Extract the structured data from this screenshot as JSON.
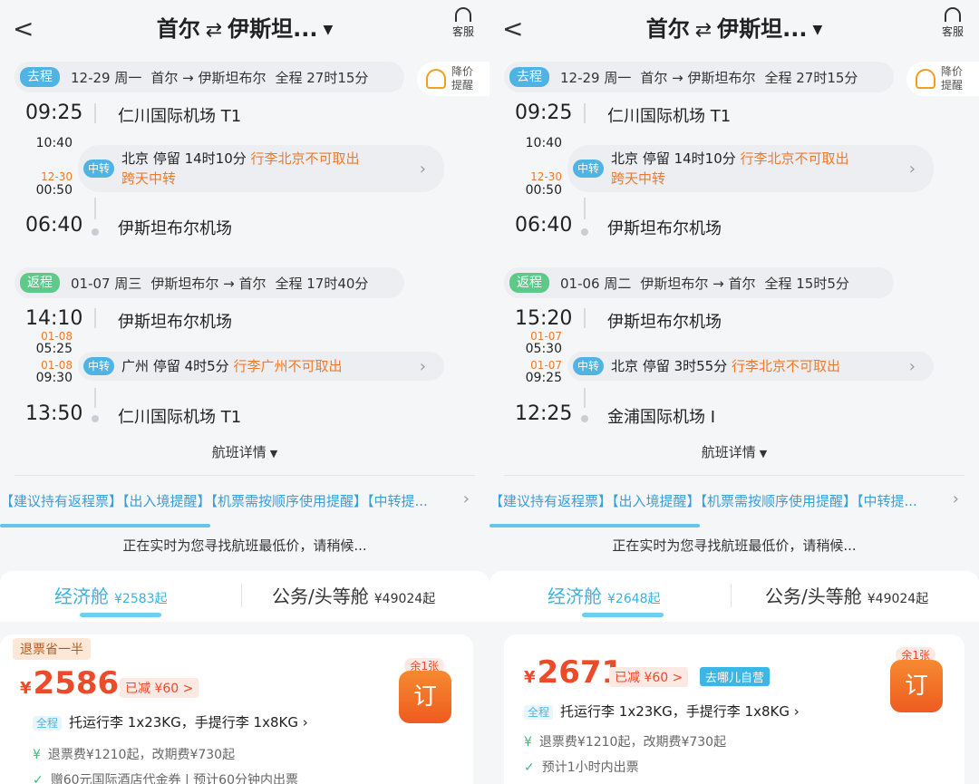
{
  "panels": [
    {
      "header": {
        "back": "<",
        "from": "首尔",
        "swap": "⇄",
        "to": "伊斯坦...",
        "caret": "▼",
        "service": "客服"
      },
      "alert": {
        "line1": "降价",
        "line2": "提醒"
      },
      "outbound": {
        "tag": "去程",
        "date": "12-29 周一",
        "route": "首尔 → 伊斯坦布尔",
        "duration": "全程 27时15分",
        "dep_time": "09:25",
        "dep_airport": "仁川国际机场 T1",
        "arr1_time": "10:40",
        "transfer_tag": "中转",
        "stop_city": "北京",
        "stop_info": "停留 14时10分",
        "stop_warn": "行李北京不可取出",
        "stop_warn2": "跨天中转",
        "dep2_date": "12-30",
        "dep2_time": "00:50",
        "arr_time": "06:40",
        "arr_airport": "伊斯坦布尔机场"
      },
      "return": {
        "tag": "返程",
        "date": "01-07 周三",
        "route": "伊斯坦布尔 → 首尔",
        "duration": "全程 17时40分",
        "dep_time": "14:10",
        "dep_airport": "伊斯坦布尔机场",
        "arr1_date": "01-08",
        "arr1_time": "05:25",
        "transfer_tag": "中转",
        "stop_city": "广州",
        "stop_info": "停留 4时5分",
        "stop_warn": "行李广州不可取出",
        "dep2_date": "01-08",
        "dep2_time": "09:30",
        "arr_time": "13:50",
        "arr_airport": "仁川国际机场 T1"
      },
      "detail": "航班详情",
      "detail_caret": "▼",
      "tips": "【建议持有返程票】【出入境提醒】【机票需按顺序使用提醒】【中转提...",
      "tips_arrow": "›",
      "search": "正在实时为您寻找航班最低价，请稍候...",
      "cabin_a": "经济舱",
      "cabin_a_price": "¥2583起",
      "cabin_b": "公务/头等舱",
      "cabin_b_price": "¥49024起",
      "card": {
        "badge": "退票省一半",
        "currency": "¥",
        "price": "2586",
        "discount": "已减 ¥60 >",
        "remain": "余1张",
        "book": "订",
        "bag_tag": "全程",
        "baggage": "托运行李 1x23KG，手提行李 1x8KG ›",
        "fee_icon": "¥",
        "fee": "退票费¥1210起，改期费¥730起",
        "gift_icon": "✓",
        "gift": "赠60元国际酒店代金券 | 预计60分钟内出票"
      }
    },
    {
      "header": {
        "back": "<",
        "from": "首尔",
        "swap": "⇄",
        "to": "伊斯坦...",
        "caret": "▼",
        "service": "客服"
      },
      "alert": {
        "line1": "降价",
        "line2": "提醒"
      },
      "outbound": {
        "tag": "去程",
        "date": "12-29 周一",
        "route": "首尔 → 伊斯坦布尔",
        "duration": "全程 27时15分",
        "dep_time": "09:25",
        "dep_airport": "仁川国际机场 T1",
        "arr1_time": "10:40",
        "transfer_tag": "中转",
        "stop_city": "北京",
        "stop_info": "停留 14时10分",
        "stop_warn": "行李北京不可取出",
        "stop_warn2": "跨天中转",
        "dep2_date": "12-30",
        "dep2_time": "00:50",
        "arr_time": "06:40",
        "arr_airport": "伊斯坦布尔机场"
      },
      "return": {
        "tag": "返程",
        "date": "01-06 周二",
        "route": "伊斯坦布尔 → 首尔",
        "duration": "全程 15时5分",
        "dep_time": "15:20",
        "dep_airport": "伊斯坦布尔机场",
        "arr1_date": "01-07",
        "arr1_time": "05:30",
        "transfer_tag": "中转",
        "stop_city": "北京",
        "stop_info": "停留 3时55分",
        "stop_warn": "行李北京不可取出",
        "dep2_date": "01-07",
        "dep2_time": "09:25",
        "arr_time": "12:25",
        "arr_airport": "金浦国际机场 I"
      },
      "detail": "航班详情",
      "detail_caret": "▼",
      "tips": "【建议持有返程票】【出入境提醒】【机票需按顺序使用提醒】【中转提...",
      "tips_arrow": "›",
      "search": "正在实时为您寻找航班最低价，请稍候...",
      "cabin_a": "经济舱",
      "cabin_a_price": "¥2648起",
      "cabin_b": "公务/头等舱",
      "cabin_b_price": "¥49024起",
      "card": {
        "currency": "¥",
        "price": "2671",
        "discount": "已减 ¥60 >",
        "self_op": "去哪儿自营",
        "remain": "余1张",
        "book": "订",
        "bag_tag": "全程",
        "baggage": "托运行李 1x23KG，手提行李 1x8KG ›",
        "fee_icon": "¥",
        "fee": "退票费¥1210起，改期费¥730起",
        "gift_icon": "✓",
        "gift": "预计1小时内出票"
      }
    }
  ]
}
